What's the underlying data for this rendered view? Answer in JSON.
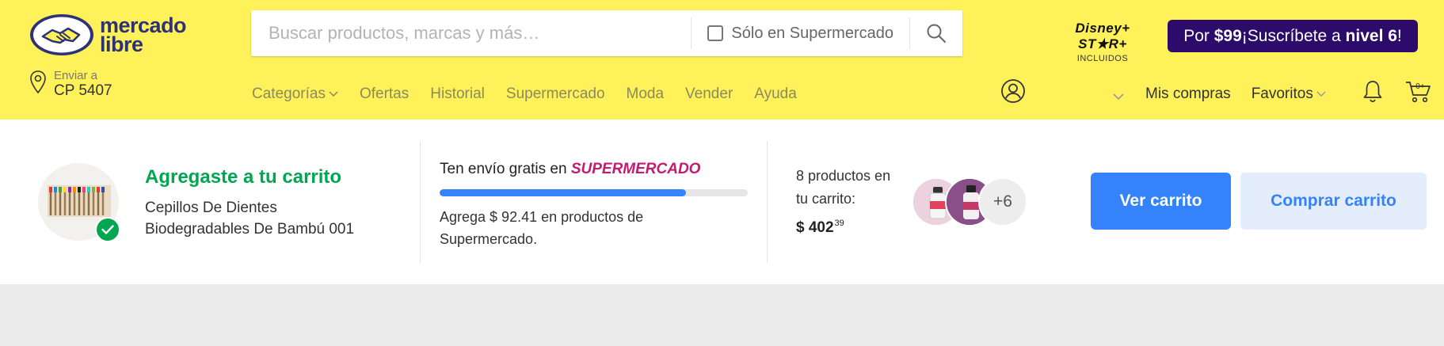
{
  "header": {
    "logo_text_line1": "mercado",
    "logo_text_line2": "libre",
    "search": {
      "placeholder": "Buscar productos, marcas y más…",
      "supermarket_only_label": "Sólo en Supermercado"
    },
    "disney_logos": "Disney+ ST★R+",
    "disney_sub": "INCLUIDOS",
    "promo": {
      "prefix": "Por ",
      "price": "$99",
      "middle": " ¡Suscríbete a ",
      "level": "nivel 6",
      "suffix": "!"
    },
    "location": {
      "label": "Enviar a",
      "value": "CP 5407"
    },
    "nav": [
      "Categorías",
      "Ofertas",
      "Historial",
      "Supermercado",
      "Moda",
      "Vender",
      "Ayuda"
    ],
    "right_nav": {
      "purchases": "Mis compras",
      "favorites": "Favoritos",
      "cart_count": "0+"
    },
    "colors": {
      "background": "#fff159",
      "brand_blue": "#2d3277"
    }
  },
  "panel": {
    "added_title": "Agregaste a tu carrito",
    "product_name": "Cepillos De Dientes Biodegradables De Bambú 001",
    "free_shipping": {
      "title_prefix": "Ten envío gratis en ",
      "title_brand": "SUPERMERCADO",
      "progress_fraction": 0.8,
      "description": "Agrega $ 92.41 en productos de Supermercado."
    },
    "cart_summary": {
      "count_text": "8 productos en tu carrito:",
      "total_main": "$ 402",
      "total_cents": "39",
      "more_count": "+6"
    },
    "buttons": {
      "view_cart": "Ver carrito",
      "buy_cart": "Comprar carrito"
    },
    "colors": {
      "success": "#00a650",
      "accent": "#3483fa",
      "supermarket": "#c41a6f"
    }
  }
}
